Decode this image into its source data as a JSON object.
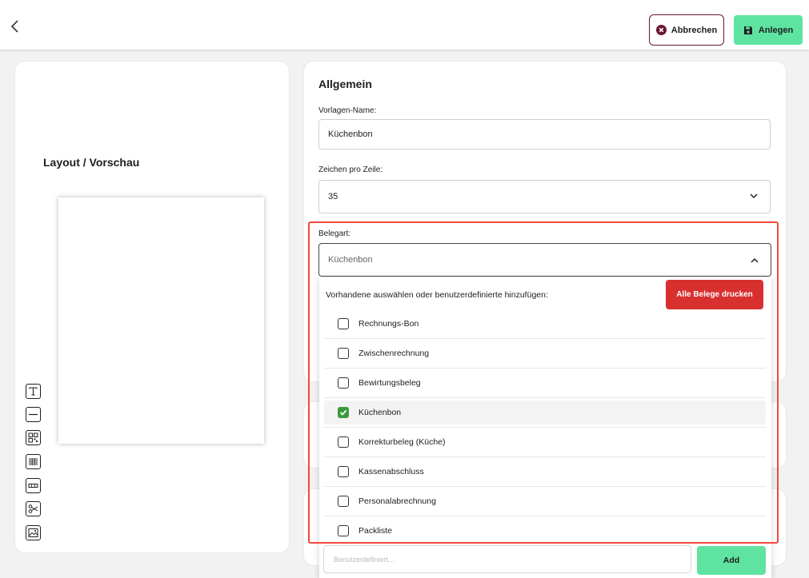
{
  "header": {
    "cancel_label": "Abbrechen",
    "create_label": "Anlegen",
    "cancel_color": "#6a1630",
    "create_color": "#5fe3a1"
  },
  "preview": {
    "title": "Layout / Vorschau",
    "tools": [
      "text-icon",
      "line-icon",
      "qr-code-icon",
      "barcode-icon",
      "spacer-icon",
      "scissors-icon",
      "image-icon"
    ]
  },
  "general": {
    "title": "Allgemein",
    "template_name_label": "Vorlagen-Name:",
    "template_name_value": "Küchenbon",
    "chars_per_line_label": "Zeichen pro Zeile:",
    "chars_per_line_value": "35"
  },
  "belegart": {
    "label": "Belegart:",
    "selected_value": "Küchenbon",
    "hint": "Vorhandene auswählen oder benutzerdefinierte hinzufügen:",
    "print_all_label": "Alle Belege drucken",
    "print_all_color": "#d8302f",
    "options": [
      {
        "label": "Rechnungs-Bon",
        "checked": false
      },
      {
        "label": "Zwischenrechnung",
        "checked": false
      },
      {
        "label": "Bewirtungsbeleg",
        "checked": false
      },
      {
        "label": "Küchenbon",
        "checked": true
      },
      {
        "label": "Korrekturbeleg (Küche)",
        "checked": false
      },
      {
        "label": "Kassenabschluss",
        "checked": false
      },
      {
        "label": "Personalabrechnung",
        "checked": false
      },
      {
        "label": "Packliste",
        "checked": false
      }
    ],
    "custom_placeholder": "Benutzerdefiniert...",
    "add_label": "Add",
    "highlight_color": "#ef4a3b"
  }
}
